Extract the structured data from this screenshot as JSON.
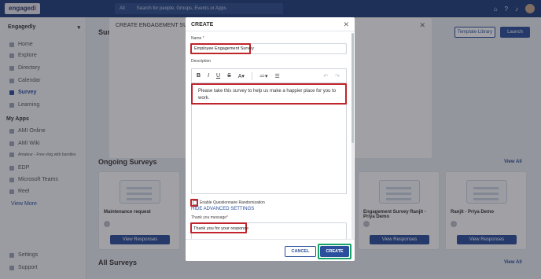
{
  "topbar": {
    "logo_text": "engaged",
    "logo_dot": "i",
    "search_scope": "All",
    "search_placeholder": "Search for people, Groups, Events or Apps"
  },
  "sidebar": {
    "org": "Engagedly",
    "items": [
      {
        "label": "Home"
      },
      {
        "label": "Explore"
      },
      {
        "label": "Directory"
      },
      {
        "label": "Calendar"
      },
      {
        "label": "Survey"
      },
      {
        "label": "Learning"
      }
    ],
    "apps_heading": "My Apps",
    "apps": [
      {
        "label": "AMI Online"
      },
      {
        "label": "AMI Wiki"
      },
      {
        "label": "Amateur - Free vlog with bundles"
      },
      {
        "label": "EDP"
      },
      {
        "label": "Microsoft Teams"
      },
      {
        "label": "Reel"
      }
    ],
    "view_more": "View More",
    "bottom": [
      {
        "label": "Settings"
      },
      {
        "label": "Support"
      }
    ]
  },
  "main": {
    "title": "Surveys",
    "template_library": "Template Library",
    "launch": "Launch",
    "ongoing_title": "Ongoing Surveys",
    "all_title": "All Surveys",
    "view_all": "View All",
    "cards": [
      {
        "title": "Maintenance request",
        "button": "View Responses"
      },
      {
        "title": "Engagement Survey Ranjit - Priya Demo",
        "button": "View Responses"
      },
      {
        "title": "Ranjit - Priya Demo",
        "button": "View Responses"
      }
    ]
  },
  "back_modal": {
    "title": "CREATE ENGAGEMENT SURVEY"
  },
  "modal": {
    "title": "CREATE",
    "name_label": "Name",
    "name_req": "*",
    "name_value": "Employee Engagement Survey",
    "desc_label": "Description",
    "toolbar": {
      "bold": "B",
      "italic": "I",
      "underline": "U",
      "strike": "S",
      "size": "A▾",
      "bullets": "≔▾",
      "numbered": "☰",
      "undo": "↶",
      "redo": "↷"
    },
    "desc_value": "Please take this survey to help us make a happier place for you to work.",
    "randomize_label": "Enable Questionnaire Randomization",
    "hide_advanced": "HIDE ADVANCED SETTINGS",
    "thanks_label": "Thank you message",
    "thanks_req": "*",
    "thanks_value": "Thank you for your response",
    "cancel": "CANCEL",
    "create": "CREATE"
  },
  "colors": {
    "primary": "#2a4f9c",
    "topbar": "#1f3d7a",
    "highlight_red": "#c0242c",
    "highlight_green": "#16a36a"
  }
}
